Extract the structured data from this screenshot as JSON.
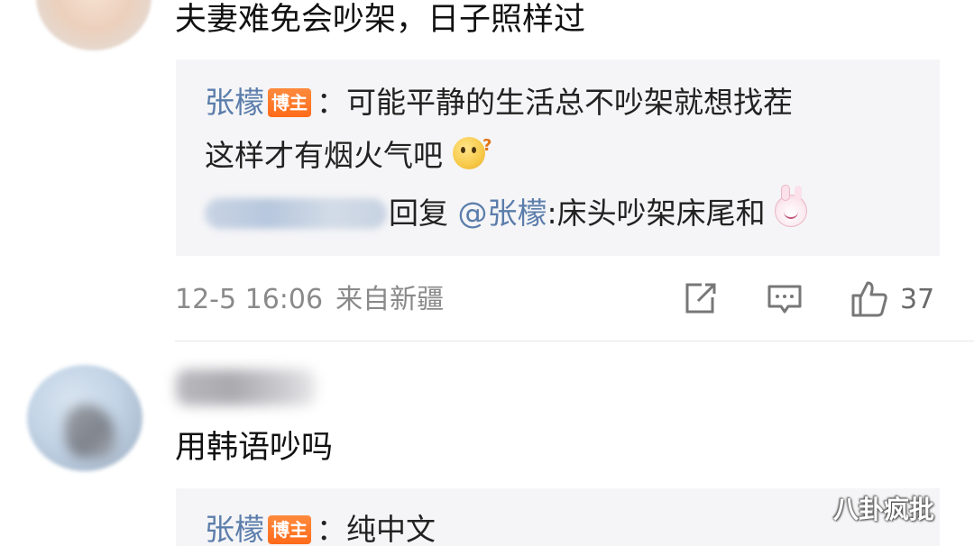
{
  "comments": [
    {
      "text": "夫妻难免会吵架，日子照样过",
      "replies": [
        {
          "author": "张檬",
          "badge": "博主",
          "line1": "：可能平静的生活总不吵架就想找茬",
          "line2": "这样才有烟火气吧",
          "emoji": "thinking-face-icon"
        },
        {
          "reply_word": "回复",
          "mention": "@张檬",
          "text": ":床头吵架床尾和",
          "emoji": "bunny-icon"
        }
      ],
      "meta": {
        "time": "12-5 16:06",
        "location": "来自新疆"
      },
      "actions": {
        "share_icon": "share-icon",
        "comment_icon": "comment-icon",
        "like_icon": "thumbs-up-icon",
        "like_count": "37"
      }
    },
    {
      "text": "用韩语吵吗",
      "replies": [
        {
          "author": "张檬",
          "badge": "博主",
          "line1": "：纯中文"
        }
      ]
    }
  ],
  "watermark": "八卦疯批",
  "colors": {
    "username": "#5b7dab",
    "badge": "#ff6b1a",
    "reply_bg": "#f5f5f7",
    "meta_text": "#8a8a8a"
  }
}
